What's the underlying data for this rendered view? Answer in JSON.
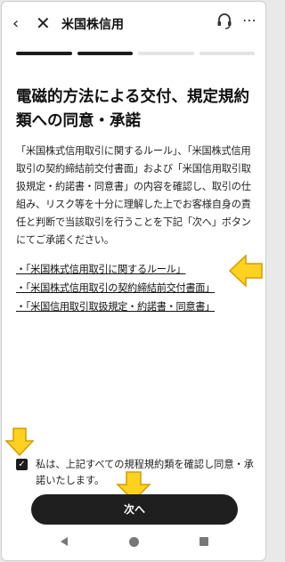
{
  "header": {
    "back_glyph": "‹",
    "close_glyph": "✕",
    "title": "米国株信用",
    "support_icon": "headset-icon",
    "more_glyph": "⋯"
  },
  "progress": {
    "total_steps": 4,
    "completed_steps": 2
  },
  "main": {
    "title": "電磁的方法による交付、規定規約類への同意・承諾",
    "body": "「米国株式信用取引に関するルール」、「米国株式信用取引の契約締結前交付書面」および「米国信用取引取扱規定・約諾書・同意書」の内容を確認し、取引の仕組み、リスク等を十分に理解した上でお客様自身の責任と判断で当該取引を行うことを下記「次へ」ボタンにてご承諾ください。",
    "links": [
      "・「米国株式信用取引に関するルール」",
      "・「米国株式信用取引の契約締結前交付書面」",
      "・「米国信用取引取扱規定・約諾書・同意書」"
    ]
  },
  "consent": {
    "checked": true,
    "check_glyph": "✓",
    "label": "私は、上記すべての規程規約類を確認し同意・承諾いたします。"
  },
  "next_button": {
    "label": "次へ"
  },
  "annotation": {
    "arrow_color": "#ffd21f",
    "arrow_stroke": "#d69a00"
  }
}
